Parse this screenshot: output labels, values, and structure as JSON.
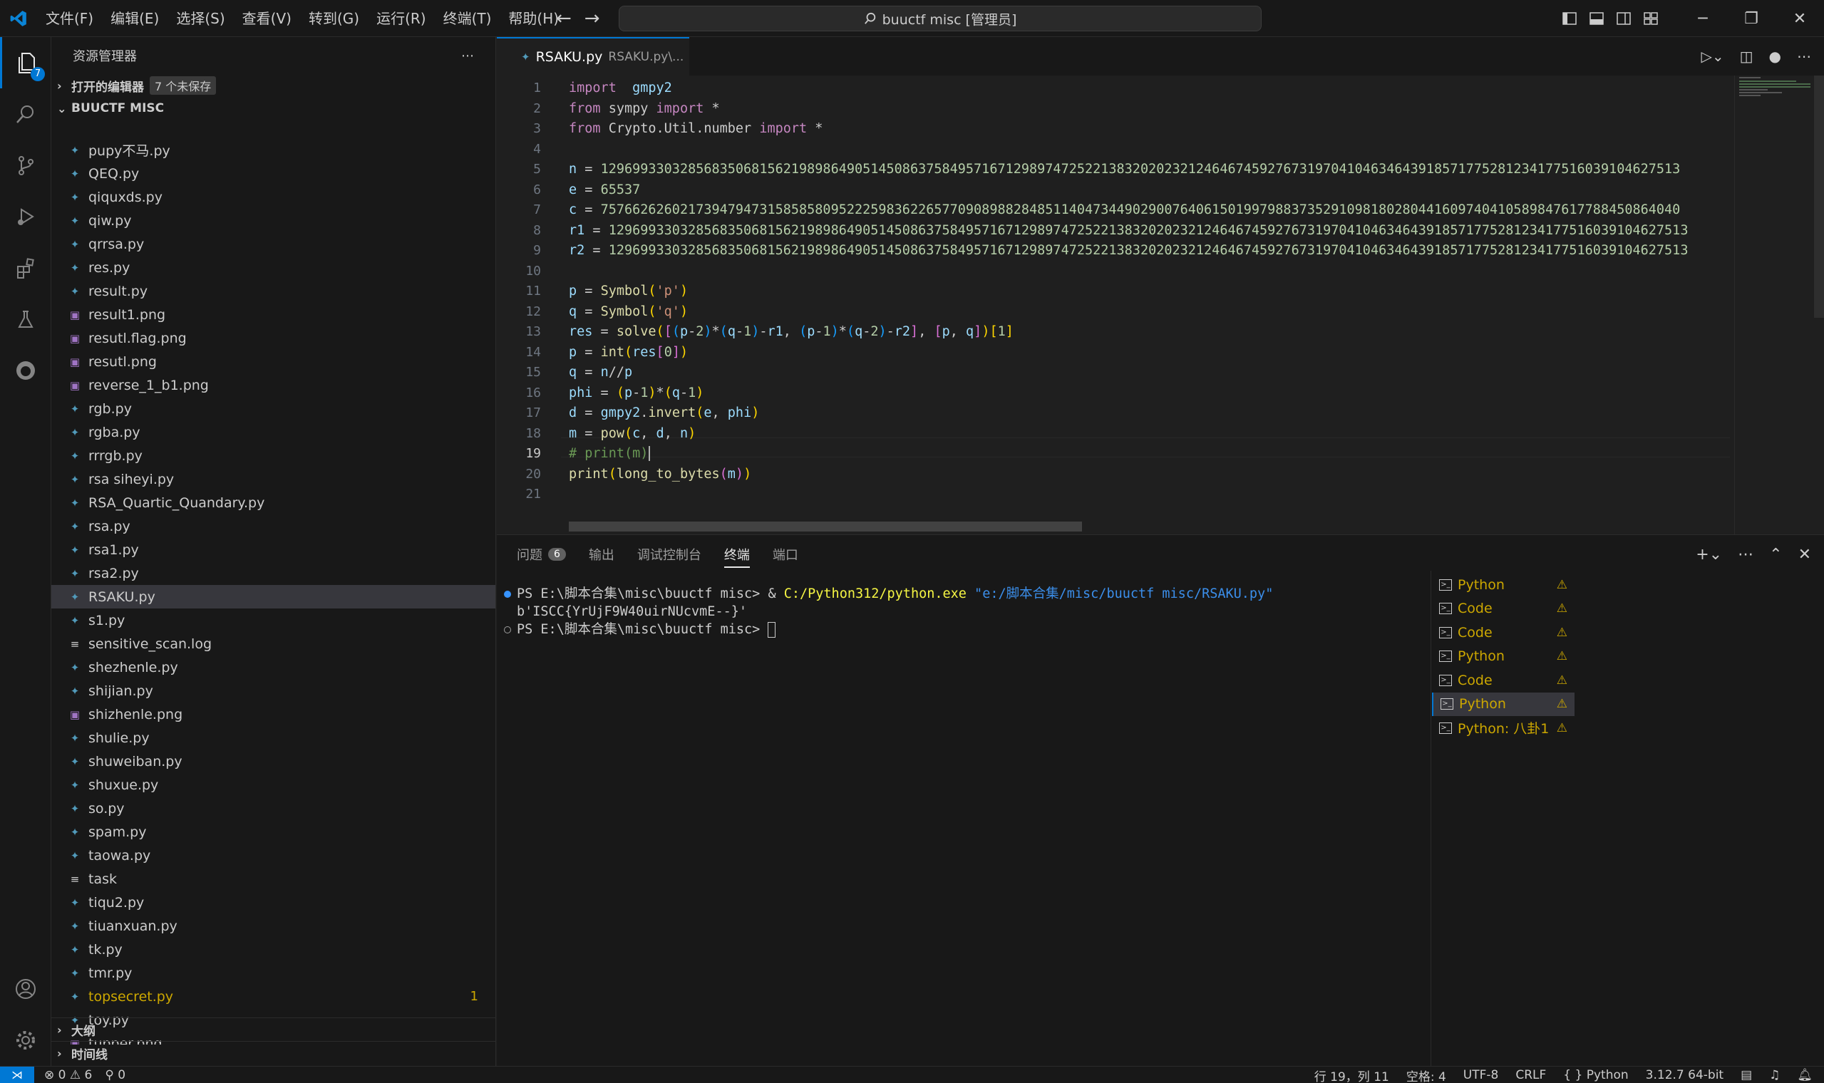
{
  "titlebar": {
    "menu": [
      "文件(F)",
      "编辑(E)",
      "选择(S)",
      "查看(V)",
      "转到(G)",
      "运行(R)",
      "终端(T)",
      "帮助(H)"
    ],
    "search": "buuctf misc [管理员]"
  },
  "activity": {
    "explorer_badge": "7"
  },
  "sidebar": {
    "title": "资源管理器",
    "open_editors": "打开的编辑器",
    "unsaved": "7 个未保存",
    "folder": "BUUCTF MISC",
    "outline": "大纲",
    "timeline": "时间线",
    "files": [
      {
        "name": "pupy不马.py",
        "type": "py"
      },
      {
        "name": "QEQ.py",
        "type": "py"
      },
      {
        "name": "qiquxds.py",
        "type": "py"
      },
      {
        "name": "qiw.py",
        "type": "py"
      },
      {
        "name": "qrrsa.py",
        "type": "py"
      },
      {
        "name": "res.py",
        "type": "py"
      },
      {
        "name": "result.py",
        "type": "py"
      },
      {
        "name": "result1.png",
        "type": "img"
      },
      {
        "name": "resutl.flag.png",
        "type": "img"
      },
      {
        "name": "resutl.png",
        "type": "img"
      },
      {
        "name": "reverse_1_b1.png",
        "type": "img"
      },
      {
        "name": "rgb.py",
        "type": "py"
      },
      {
        "name": "rgba.py",
        "type": "py"
      },
      {
        "name": "rrrgb.py",
        "type": "py"
      },
      {
        "name": "rsa siheyi.py",
        "type": "py"
      },
      {
        "name": "RSA_Quartic_Quandary.py",
        "type": "py"
      },
      {
        "name": "rsa.py",
        "type": "py"
      },
      {
        "name": "rsa1.py",
        "type": "py"
      },
      {
        "name": "rsa2.py",
        "type": "py"
      },
      {
        "name": "RSAKU.py",
        "type": "py",
        "selected": true
      },
      {
        "name": "s1.py",
        "type": "py"
      },
      {
        "name": "sensitive_scan.log",
        "type": "txt"
      },
      {
        "name": "shezhenle.py",
        "type": "py"
      },
      {
        "name": "shijian.py",
        "type": "py"
      },
      {
        "name": "shizhenle.png",
        "type": "img"
      },
      {
        "name": "shulie.py",
        "type": "py"
      },
      {
        "name": "shuweiban.py",
        "type": "py"
      },
      {
        "name": "shuxue.py",
        "type": "py"
      },
      {
        "name": "so.py",
        "type": "py"
      },
      {
        "name": "spam.py",
        "type": "py"
      },
      {
        "name": "taowa.py",
        "type": "py"
      },
      {
        "name": "task",
        "type": "txt"
      },
      {
        "name": "tiqu2.py",
        "type": "py"
      },
      {
        "name": "tiuanxuan.py",
        "type": "py"
      },
      {
        "name": "tk.py",
        "type": "py"
      },
      {
        "name": "tmr.py",
        "type": "py"
      },
      {
        "name": "topsecret.py",
        "type": "py",
        "warn": true,
        "count": "1"
      },
      {
        "name": "toy.py",
        "type": "py"
      },
      {
        "name": "tupper.png",
        "type": "img"
      }
    ]
  },
  "editor": {
    "tab_name": "RSAKU.py",
    "tab_path": "RSAKU.py\\...",
    "lines": [
      [
        [
          "kw",
          "import"
        ],
        [
          "",
          "  "
        ],
        [
          "var",
          "gmpy2"
        ]
      ],
      [
        [
          "kw",
          "from"
        ],
        [
          "",
          " sympy "
        ],
        [
          "kw",
          "import"
        ],
        [
          "",
          " *"
        ]
      ],
      [
        [
          "kw",
          "from"
        ],
        [
          "",
          " Crypto.Util.number "
        ],
        [
          "kw",
          "import"
        ],
        [
          "",
          " *"
        ]
      ],
      [],
      [
        [
          "var",
          "n"
        ],
        [
          "",
          " = "
        ],
        [
          "num",
          "1296993303285683506815621989864905145086375849571671298974725221383202023212464674592767319704104634643918571775281234177516039104627513"
        ]
      ],
      [
        [
          "var",
          "e"
        ],
        [
          "",
          " = "
        ],
        [
          "num",
          "65537"
        ]
      ],
      [
        [
          "var",
          "c"
        ],
        [
          "",
          " = "
        ],
        [
          "num",
          "7576626260217394794731585858095222598362265770908988284851140473449029007640615019979883735291098180280441609740410589847617788450864040"
        ]
      ],
      [
        [
          "var",
          "r1"
        ],
        [
          "",
          " = "
        ],
        [
          "num",
          "1296993303285683506815621989864905145086375849571671298974725221383202023212464674592767319704104634643918571775281234177516039104627513"
        ]
      ],
      [
        [
          "var",
          "r2"
        ],
        [
          "",
          " = "
        ],
        [
          "num",
          "1296993303285683506815621989864905145086375849571671298974725221383202023212464674592767319704104634643918571775281234177516039104627513"
        ]
      ],
      [],
      [
        [
          "var",
          "p"
        ],
        [
          "",
          " = "
        ],
        [
          "fn",
          "Symbol"
        ],
        [
          "br1",
          "("
        ],
        [
          "str",
          "'p'"
        ],
        [
          "br1",
          ")"
        ]
      ],
      [
        [
          "var",
          "q"
        ],
        [
          "",
          " = "
        ],
        [
          "fn",
          "Symbol"
        ],
        [
          "br1",
          "("
        ],
        [
          "str",
          "'q'"
        ],
        [
          "br1",
          ")"
        ]
      ],
      [
        [
          "var",
          "res"
        ],
        [
          "",
          " = "
        ],
        [
          "fn",
          "solve"
        ],
        [
          "br1",
          "("
        ],
        [
          "br2",
          "["
        ],
        [
          "br3",
          "("
        ],
        [
          "var",
          "p"
        ],
        [
          "",
          "-"
        ],
        [
          "num",
          "2"
        ],
        [
          "br3",
          ")"
        ],
        [
          "",
          "*"
        ],
        [
          "br3",
          "("
        ],
        [
          "var",
          "q"
        ],
        [
          "",
          "-"
        ],
        [
          "num",
          "1"
        ],
        [
          "br3",
          ")"
        ],
        [
          "",
          "-"
        ],
        [
          "var",
          "r1"
        ],
        [
          ", "
        ],
        [
          "br3",
          "("
        ],
        [
          "var",
          "p"
        ],
        [
          "",
          "-"
        ],
        [
          "num",
          "1"
        ],
        [
          "br3",
          ")"
        ],
        [
          "",
          "*"
        ],
        [
          "br3",
          "("
        ],
        [
          "var",
          "q"
        ],
        [
          "",
          "-"
        ],
        [
          "num",
          "2"
        ],
        [
          "br3",
          ")"
        ],
        [
          "",
          "-"
        ],
        [
          "var",
          "r2"
        ],
        [
          "br2",
          "]"
        ],
        [
          ", "
        ],
        [
          "br2",
          "["
        ],
        [
          "var",
          "p"
        ],
        [
          ", "
        ],
        [
          "var",
          "q"
        ],
        [
          "br2",
          "]"
        ],
        [
          "br1",
          ")"
        ],
        [
          "br1",
          "["
        ],
        [
          "num",
          "1"
        ],
        [
          "br1",
          "]"
        ]
      ],
      [
        [
          "var",
          "p"
        ],
        [
          "",
          " = "
        ],
        [
          "fn",
          "int"
        ],
        [
          "br1",
          "("
        ],
        [
          "var",
          "res"
        ],
        [
          "br2",
          "["
        ],
        [
          "num",
          "0"
        ],
        [
          "br2",
          "]"
        ],
        [
          "br1",
          ")"
        ]
      ],
      [
        [
          "var",
          "q"
        ],
        [
          "",
          " = "
        ],
        [
          "var",
          "n"
        ],
        [
          "",
          "//"
        ],
        [
          "var",
          "p"
        ]
      ],
      [
        [
          "var",
          "phi"
        ],
        [
          "",
          " = "
        ],
        [
          "br1",
          "("
        ],
        [
          "var",
          "p"
        ],
        [
          "",
          "-"
        ],
        [
          "num",
          "1"
        ],
        [
          "br1",
          ")"
        ],
        [
          "",
          "*"
        ],
        [
          "br1",
          "("
        ],
        [
          "var",
          "q"
        ],
        [
          "",
          "-"
        ],
        [
          "num",
          "1"
        ],
        [
          "br1",
          ")"
        ]
      ],
      [
        [
          "var",
          "d"
        ],
        [
          "",
          " = "
        ],
        [
          "var",
          "gmpy2"
        ],
        [
          "",
          "."
        ],
        [
          "fn",
          "invert"
        ],
        [
          "br1",
          "("
        ],
        [
          "var",
          "e"
        ],
        [
          ", "
        ],
        [
          "var",
          "phi"
        ],
        [
          "br1",
          ")"
        ]
      ],
      [
        [
          "var",
          "m"
        ],
        [
          "",
          " = "
        ],
        [
          "fn",
          "pow"
        ],
        [
          "br1",
          "("
        ],
        [
          "var",
          "c"
        ],
        [
          ", "
        ],
        [
          "var",
          "d"
        ],
        [
          ", "
        ],
        [
          "var",
          "n"
        ],
        [
          "br1",
          ")"
        ]
      ],
      [
        [
          "cmt",
          "# print(m)"
        ]
      ],
      [
        [
          "fn",
          "print"
        ],
        [
          "br1",
          "("
        ],
        [
          "fn",
          "long_to_bytes"
        ],
        [
          "br2",
          "("
        ],
        [
          "var",
          "m"
        ],
        [
          "br2",
          ")"
        ],
        [
          "br1",
          ")"
        ]
      ],
      []
    ],
    "current_line": 19
  },
  "panel": {
    "tabs": [
      "问题",
      "输出",
      "调试控制台",
      "终端",
      "端口"
    ],
    "problems_count": "6",
    "active_tab": "终端",
    "terminal": {
      "line1_prompt": "PS E:\\脚本合集\\misc\\buuctf misc> & ",
      "line1_exe": "C:/Python312/python.exe",
      "line1_arg": " \"e:/脚本合集/misc/buuctf misc/RSAKU.py\"",
      "line2": "b'ISCC{YrUjF9W40uirNUcvmE--}'",
      "line3": "PS E:\\脚本合集\\misc\\buuctf misc> "
    },
    "terminals": [
      {
        "name": "Python"
      },
      {
        "name": "Code"
      },
      {
        "name": "Code"
      },
      {
        "name": "Python"
      },
      {
        "name": "Code"
      },
      {
        "name": "Python",
        "selected": true
      },
      {
        "name": "Python: 八卦1"
      }
    ]
  },
  "status": {
    "errors": "0",
    "warnings": "6",
    "ports": "0",
    "position": "行 19，列 11",
    "spaces": "空格: 4",
    "encoding": "UTF-8",
    "eol": "CRLF",
    "language": "Python",
    "interpreter": "3.12.7 64-bit"
  },
  "colors": {
    "accent": "#0078d4",
    "warning": "#cca700"
  }
}
